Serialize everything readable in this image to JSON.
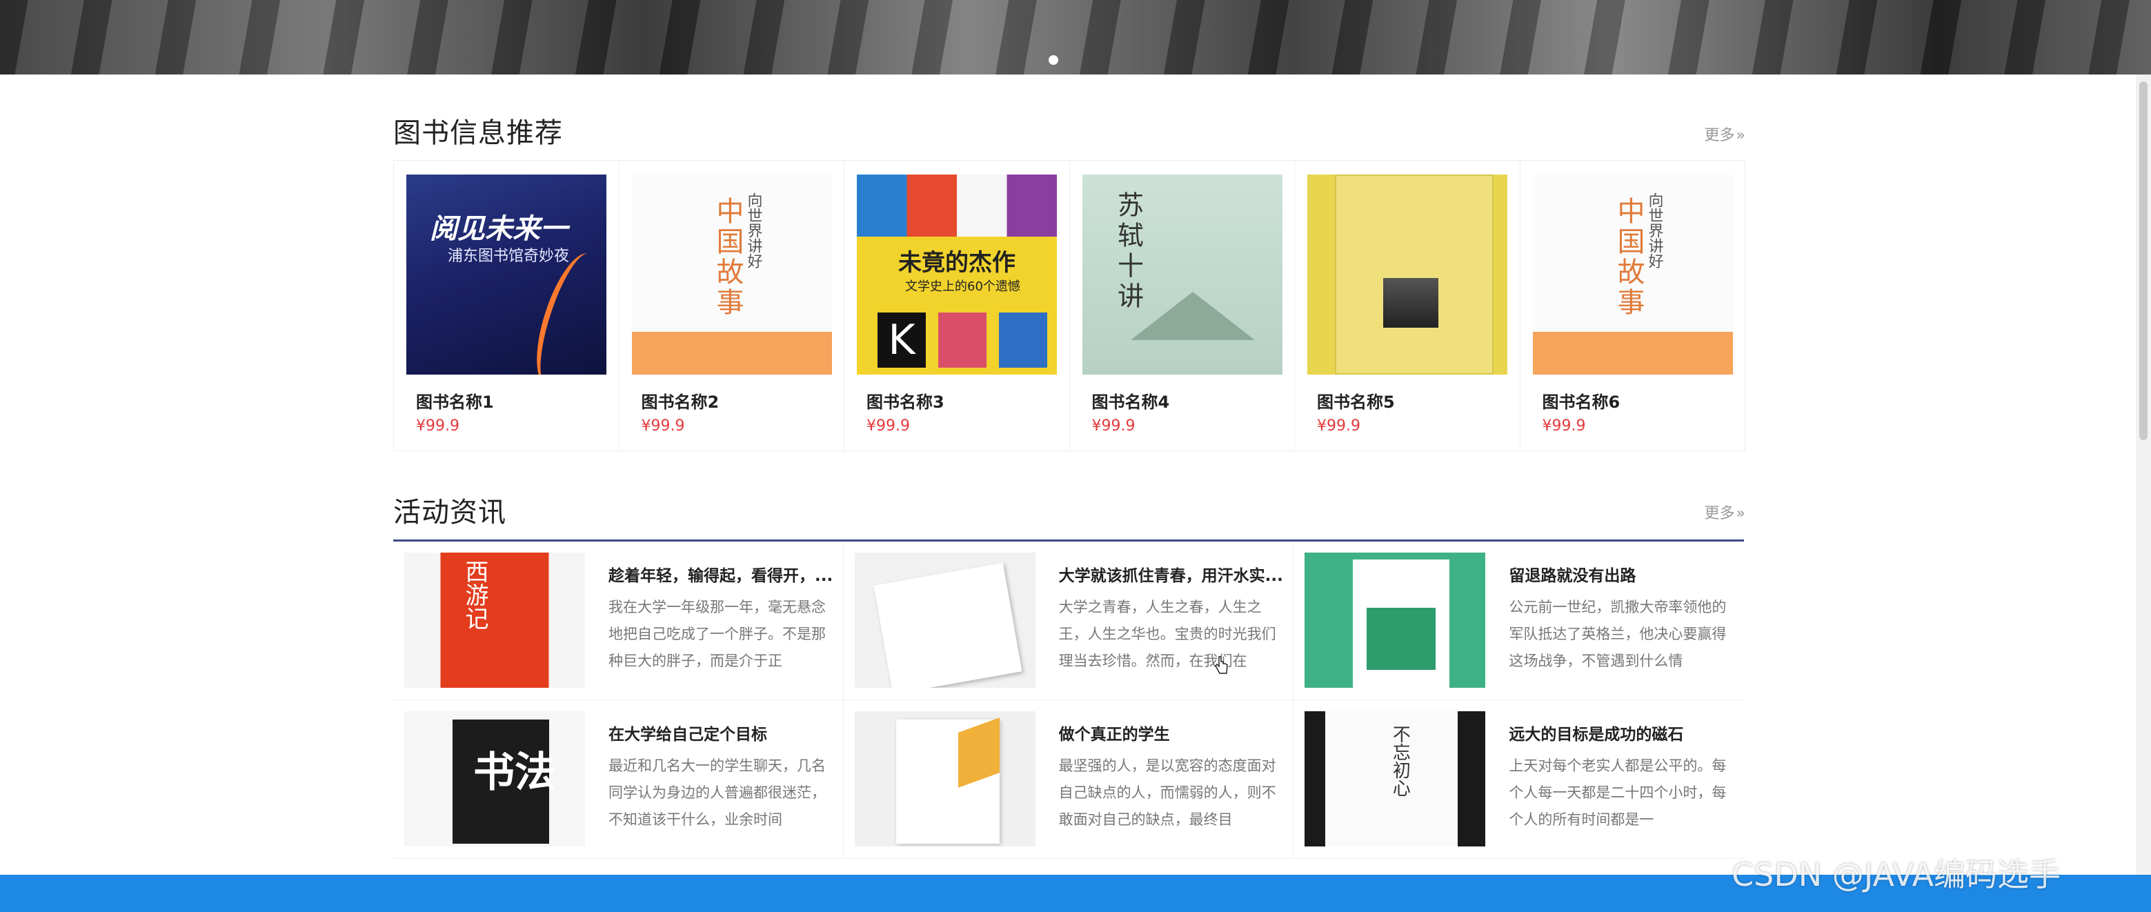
{
  "books_section": {
    "title": "图书信息推荐",
    "more": "更多",
    "items": [
      {
        "name": "图书名称1",
        "price": "¥99.9",
        "cover_title": "阅见未来一",
        "cover_sub": "浦东图书馆奇妙夜"
      },
      {
        "name": "图书名称2",
        "price": "¥99.9",
        "cover_title": "中国故事",
        "cover_sub": "向世界讲好"
      },
      {
        "name": "图书名称3",
        "price": "¥99.9",
        "cover_title": "未竟的杰作",
        "cover_sub": "文学史上的60个遗憾"
      },
      {
        "name": "图书名称4",
        "price": "¥99.9",
        "cover_title": "苏轼十讲"
      },
      {
        "name": "图书名称5",
        "price": "¥99.9"
      },
      {
        "name": "图书名称6",
        "price": "¥99.9",
        "cover_title": "中国故事",
        "cover_sub": "向世界讲好"
      }
    ]
  },
  "news_section": {
    "title": "活动资讯",
    "more": "更多",
    "items": [
      {
        "title": "趁着年轻，输得起，看得开，...",
        "text": "我在大学一年级那一年，毫无悬念地把自己吃成了一个胖子。不是那种巨大的胖子，而是介于正",
        "thumb_text": "西游记"
      },
      {
        "title": "大学就该抓住青春，用汗水实...",
        "text": "大学之青春，人生之春，人生之王，人生之华也。宝贵的时光我们理当去珍惜。然而，在我们在"
      },
      {
        "title": "留退路就没有出路",
        "text": "公元前一世纪，凯撒大帝率领他的军队抵达了英格兰，他决心要赢得这场战争，不管遇到什么情"
      },
      {
        "title": "在大学给自己定个目标",
        "text": "最近和几名大一的学生聊天，几名同学认为身边的人普遍都很迷茫，不知道该干什么，业余时间",
        "thumb_text": "书法"
      },
      {
        "title": "做个真正的学生",
        "text": "最坚强的人，是以宽容的态度面对自己缺点的人，而懦弱的人，则不敢面对自己的缺点，最终目"
      },
      {
        "title": "远大的目标是成功的磁石",
        "text": "上天对每个老实人都是公平的。每个人每一天都是二十四个小时，每个人的所有时间都是一",
        "thumb_text": "不忘初心"
      }
    ]
  },
  "watermark": "CSDN @JAVA编码选手",
  "colors": {
    "price": "#e4393c",
    "accent_line": "#3b4a86",
    "footer": "#1e88e5"
  }
}
